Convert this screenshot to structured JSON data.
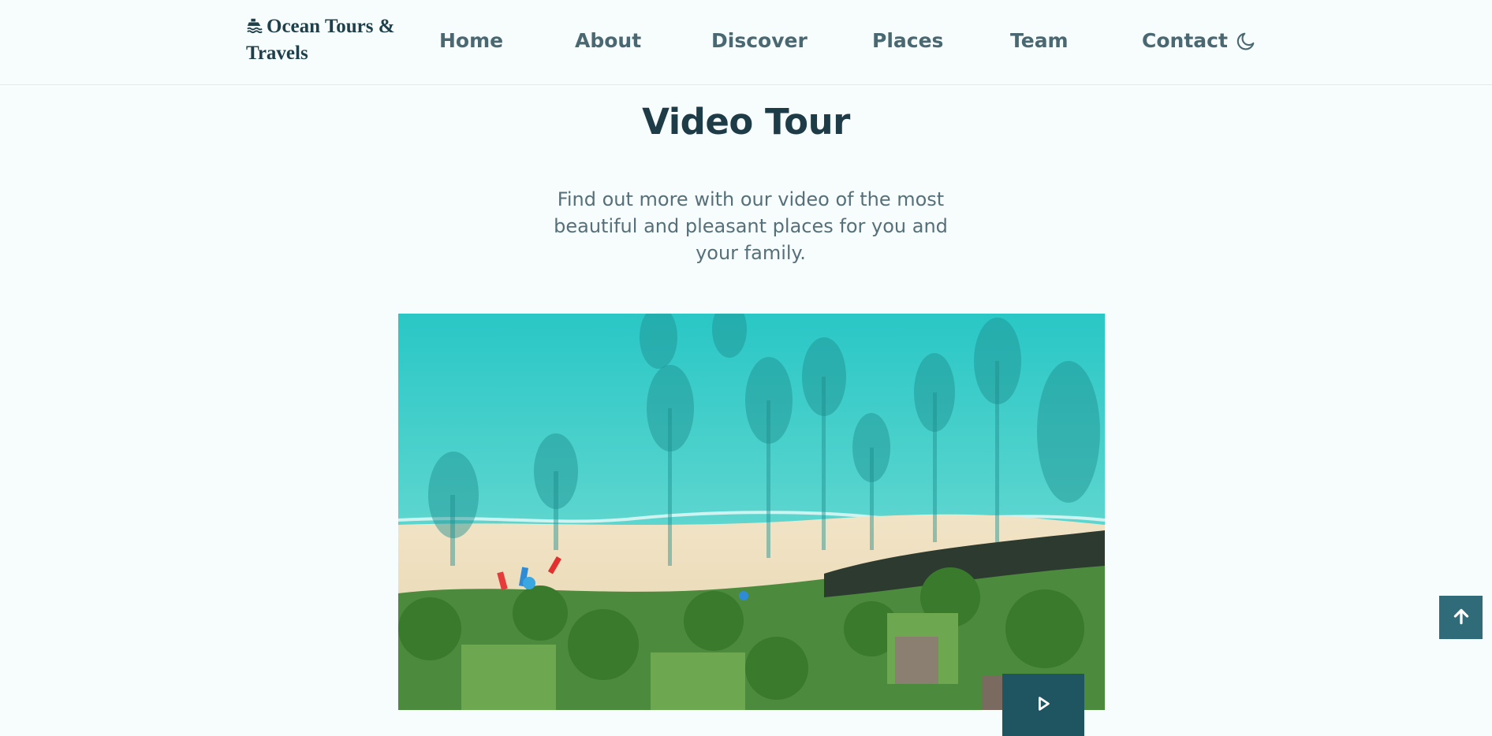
{
  "header": {
    "logo_text": "Ocean Tours & Travels",
    "logo_icon": "ship-icon",
    "nav": [
      {
        "label": "Home"
      },
      {
        "label": "About"
      },
      {
        "label": "Discover"
      },
      {
        "label": "Places"
      },
      {
        "label": "Team"
      },
      {
        "label": "Contact"
      }
    ],
    "theme_icon": "moon-icon"
  },
  "video_section": {
    "title": "Video Tour",
    "description": "Find out more with our video of the most beautiful and pleasant places for you and your family.",
    "video_image": "aerial-beach-palm-trees",
    "play_icon": "play-icon"
  },
  "scroll_top_icon": "arrow-up-icon",
  "colors": {
    "background": "#f7fcfd",
    "title": "#1d3c47",
    "play_button": "#1f5461",
    "scroll_top_button": "#2f6b78"
  }
}
